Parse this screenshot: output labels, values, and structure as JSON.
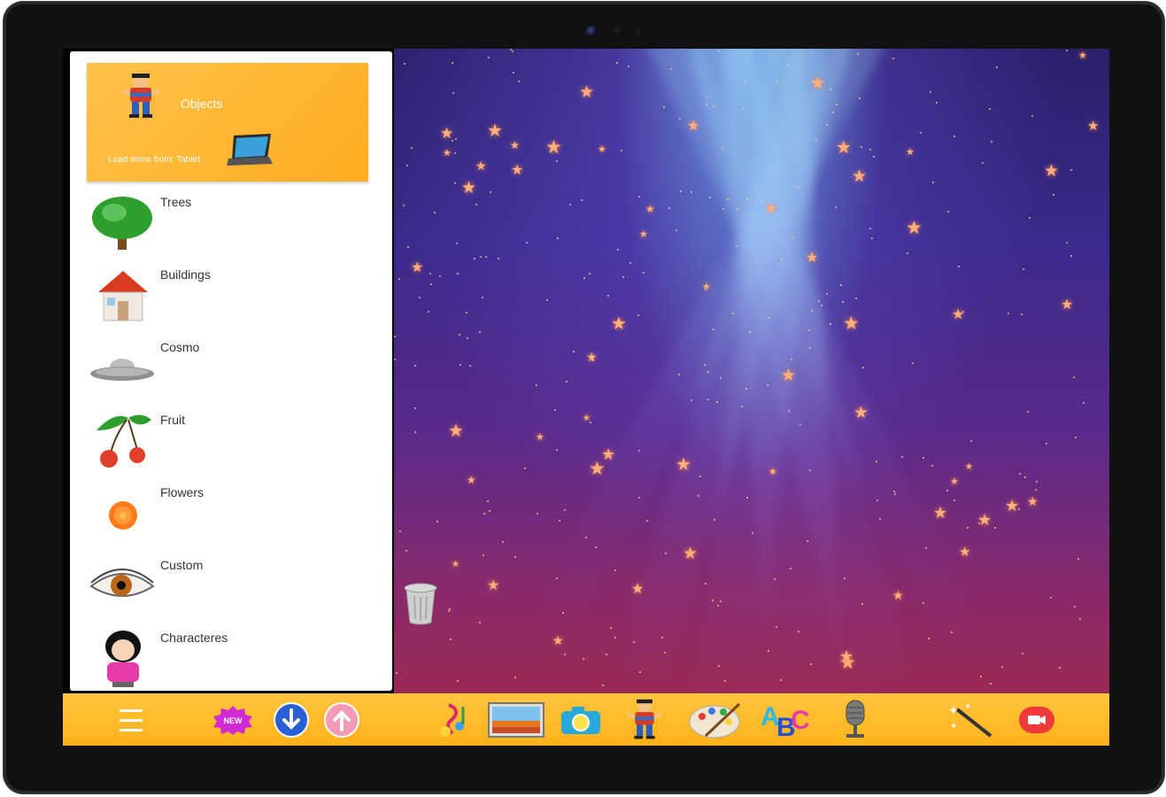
{
  "panel": {
    "header": {
      "title": "Objects",
      "subtitle": "Load items from: Tablet"
    },
    "categories": [
      {
        "label": "Trees",
        "icon": "tree-icon"
      },
      {
        "label": "Buildings",
        "icon": "house-icon"
      },
      {
        "label": "Cosmo",
        "icon": "ufo-icon"
      },
      {
        "label": "Fruit",
        "icon": "cherry-icon"
      },
      {
        "label": "Flowers",
        "icon": "flower-icon"
      },
      {
        "label": "Custom",
        "icon": "eye-icon"
      },
      {
        "label": "Characteres",
        "icon": "character-icon"
      }
    ]
  },
  "toolbar": {
    "new_badge": "NEW",
    "buttons": [
      "menu-icon",
      "new-icon",
      "download-icon",
      "upload-icon",
      "music-icon",
      "picture-icon",
      "camera-icon",
      "character-icon",
      "palette-icon",
      "abc-icon",
      "microphone-icon",
      "magic-wand-icon",
      "record-icon"
    ]
  },
  "colors": {
    "accent": "#ffb21a",
    "header_card": "#ffc24a",
    "scene_top": "#2a1f6b",
    "scene_bottom": "#9a2a55"
  }
}
